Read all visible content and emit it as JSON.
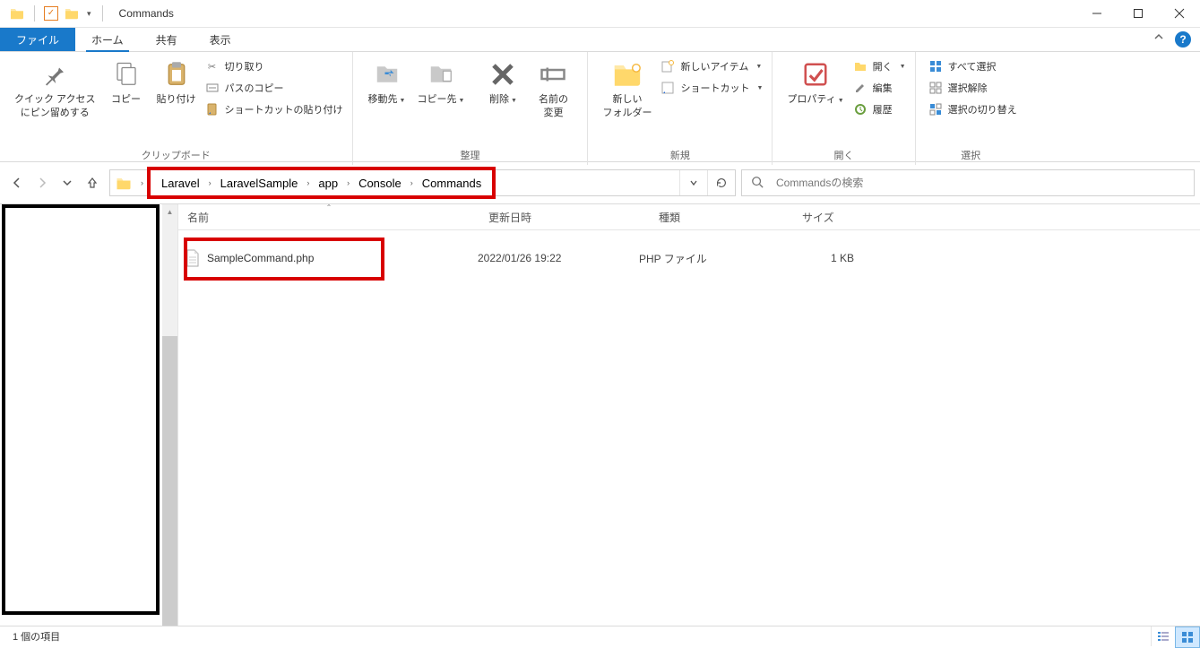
{
  "window": {
    "title": "Commands"
  },
  "tabs": {
    "file": "ファイル",
    "home": "ホーム",
    "share": "共有",
    "view": "表示"
  },
  "ribbon": {
    "clipboard": {
      "pin_quick_access_1": "クイック アクセス",
      "pin_quick_access_2": "にピン留めする",
      "copy": "コピー",
      "paste": "貼り付け",
      "cut": "切り取り",
      "copy_path": "パスのコピー",
      "paste_shortcut": "ショートカットの貼り付け",
      "label": "クリップボード"
    },
    "organize": {
      "move_to": "移動先",
      "copy_to": "コピー先",
      "delete": "削除",
      "rename_1": "名前の",
      "rename_2": "変更",
      "label": "整理"
    },
    "new": {
      "new_folder_1": "新しい",
      "new_folder_2": "フォルダー",
      "new_item": "新しいアイテム",
      "shortcut": "ショートカット",
      "label": "新規"
    },
    "open": {
      "properties": "プロパティ",
      "open": "開く",
      "edit": "編集",
      "history": "履歴",
      "label": "開く"
    },
    "select": {
      "select_all": "すべて選択",
      "select_none": "選択解除",
      "invert": "選択の切り替え",
      "label": "選択"
    }
  },
  "breadcrumb": [
    "Laravel",
    "LaravelSample",
    "app",
    "Console",
    "Commands"
  ],
  "search": {
    "placeholder": "Commandsの検索"
  },
  "columns": {
    "name": "名前",
    "date": "更新日時",
    "type": "種類",
    "size": "サイズ"
  },
  "files": [
    {
      "name": "SampleCommand.php",
      "date": "2022/01/26 19:22",
      "type": "PHP ファイル",
      "size": "1 KB"
    }
  ],
  "status": "1 個の項目"
}
